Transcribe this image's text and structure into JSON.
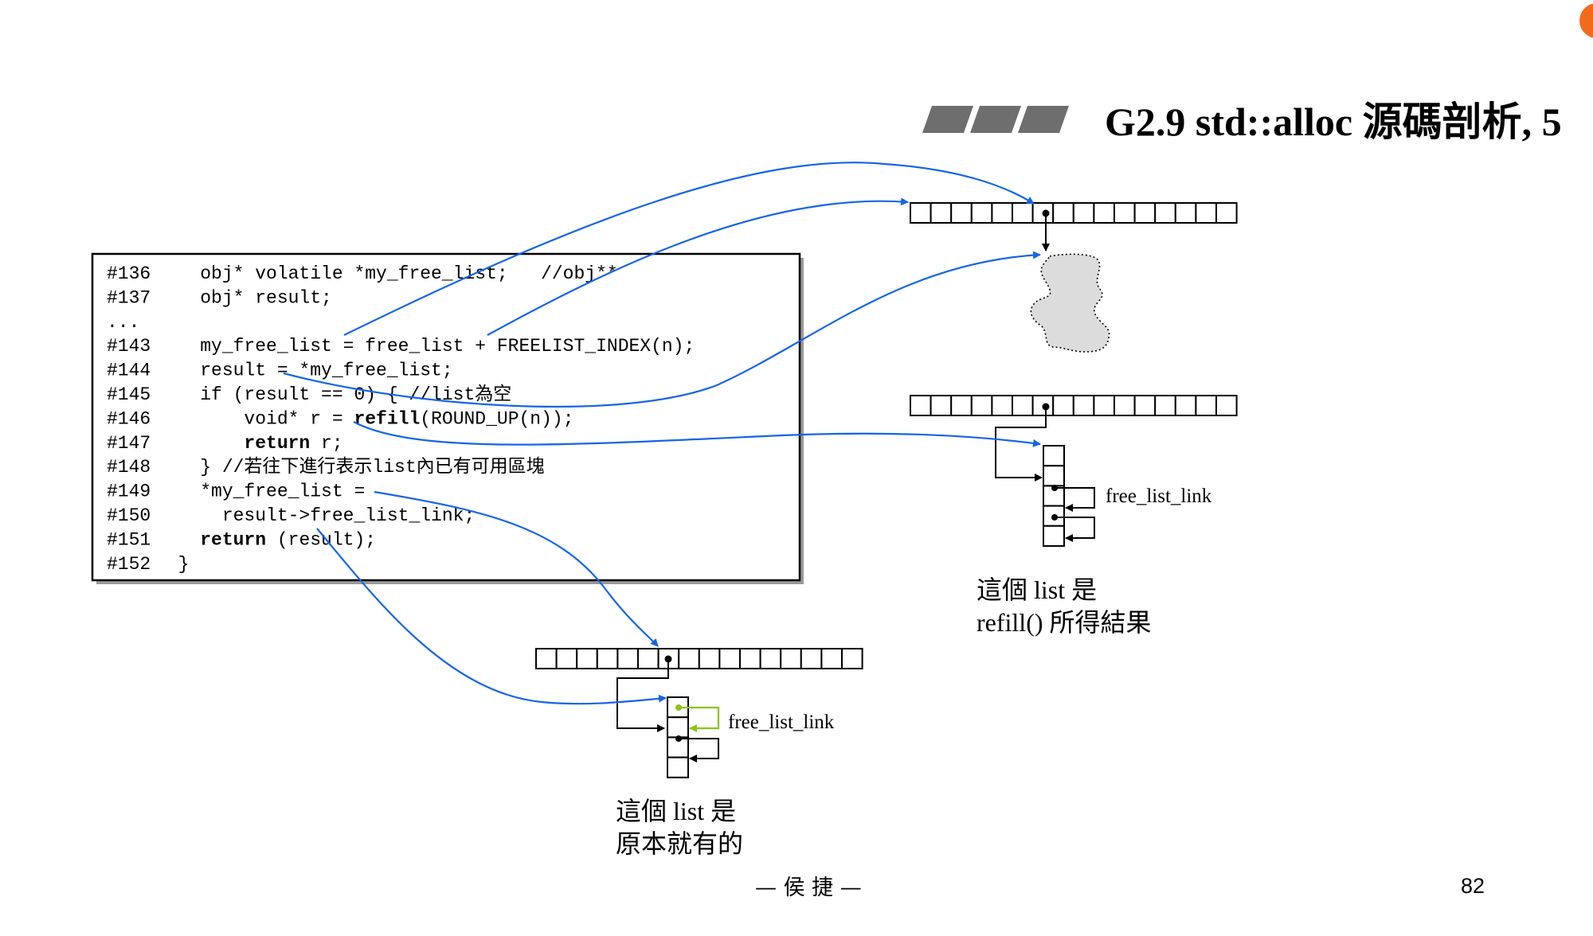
{
  "slide": {
    "title": "G2.9 std::alloc 源碼剖析, 5",
    "author": "— 侯 捷 —",
    "page_number": "82"
  },
  "code": {
    "lines": [
      {
        "num": "#136",
        "text": "    obj* volatile *my_free_list;   //obj**"
      },
      {
        "num": "#137",
        "text": "    obj* result;"
      },
      {
        "num": "...",
        "text": ""
      },
      {
        "num": "#143",
        "text": "    my_free_list = free_list + FREELIST_INDEX(n);"
      },
      {
        "num": "#144",
        "text": "    result = *my_free_list;"
      },
      {
        "num": "#145",
        "text": "    if (result == 0) { //list為空"
      },
      {
        "num": "#146",
        "pre": "        void* r = ",
        "kw": "refill",
        "post": "(ROUND_UP(n));"
      },
      {
        "num": "#147",
        "pre": "        ",
        "kw": "return",
        "post": " r;"
      },
      {
        "num": "#148",
        "text": "    } //若往下進行表示list內已有可用區塊"
      },
      {
        "num": "#149",
        "text": "    *my_free_list ="
      },
      {
        "num": "#150",
        "text": "      result->free_list_link;"
      },
      {
        "num": "#151",
        "pre": "    ",
        "kw": "return",
        "post": " (result);"
      },
      {
        "num": "#152",
        "text": "  }"
      }
    ]
  },
  "labels": {
    "free_list_link_right": "free_list_link",
    "free_list_link_bottom": "free_list_link",
    "caption_right_line1": "這個 list 是",
    "caption_right_line2": "refill() 所得結果",
    "caption_bottom_line1": "這個 list 是",
    "caption_bottom_line2": "原本就有的"
  },
  "colors": {
    "arrow": "#1565e8",
    "green_link": "#8cc41a",
    "title_bars": "#6e6e6e",
    "memory_blob": "#dcdcdc",
    "orange_badge": "#f26b1d"
  }
}
